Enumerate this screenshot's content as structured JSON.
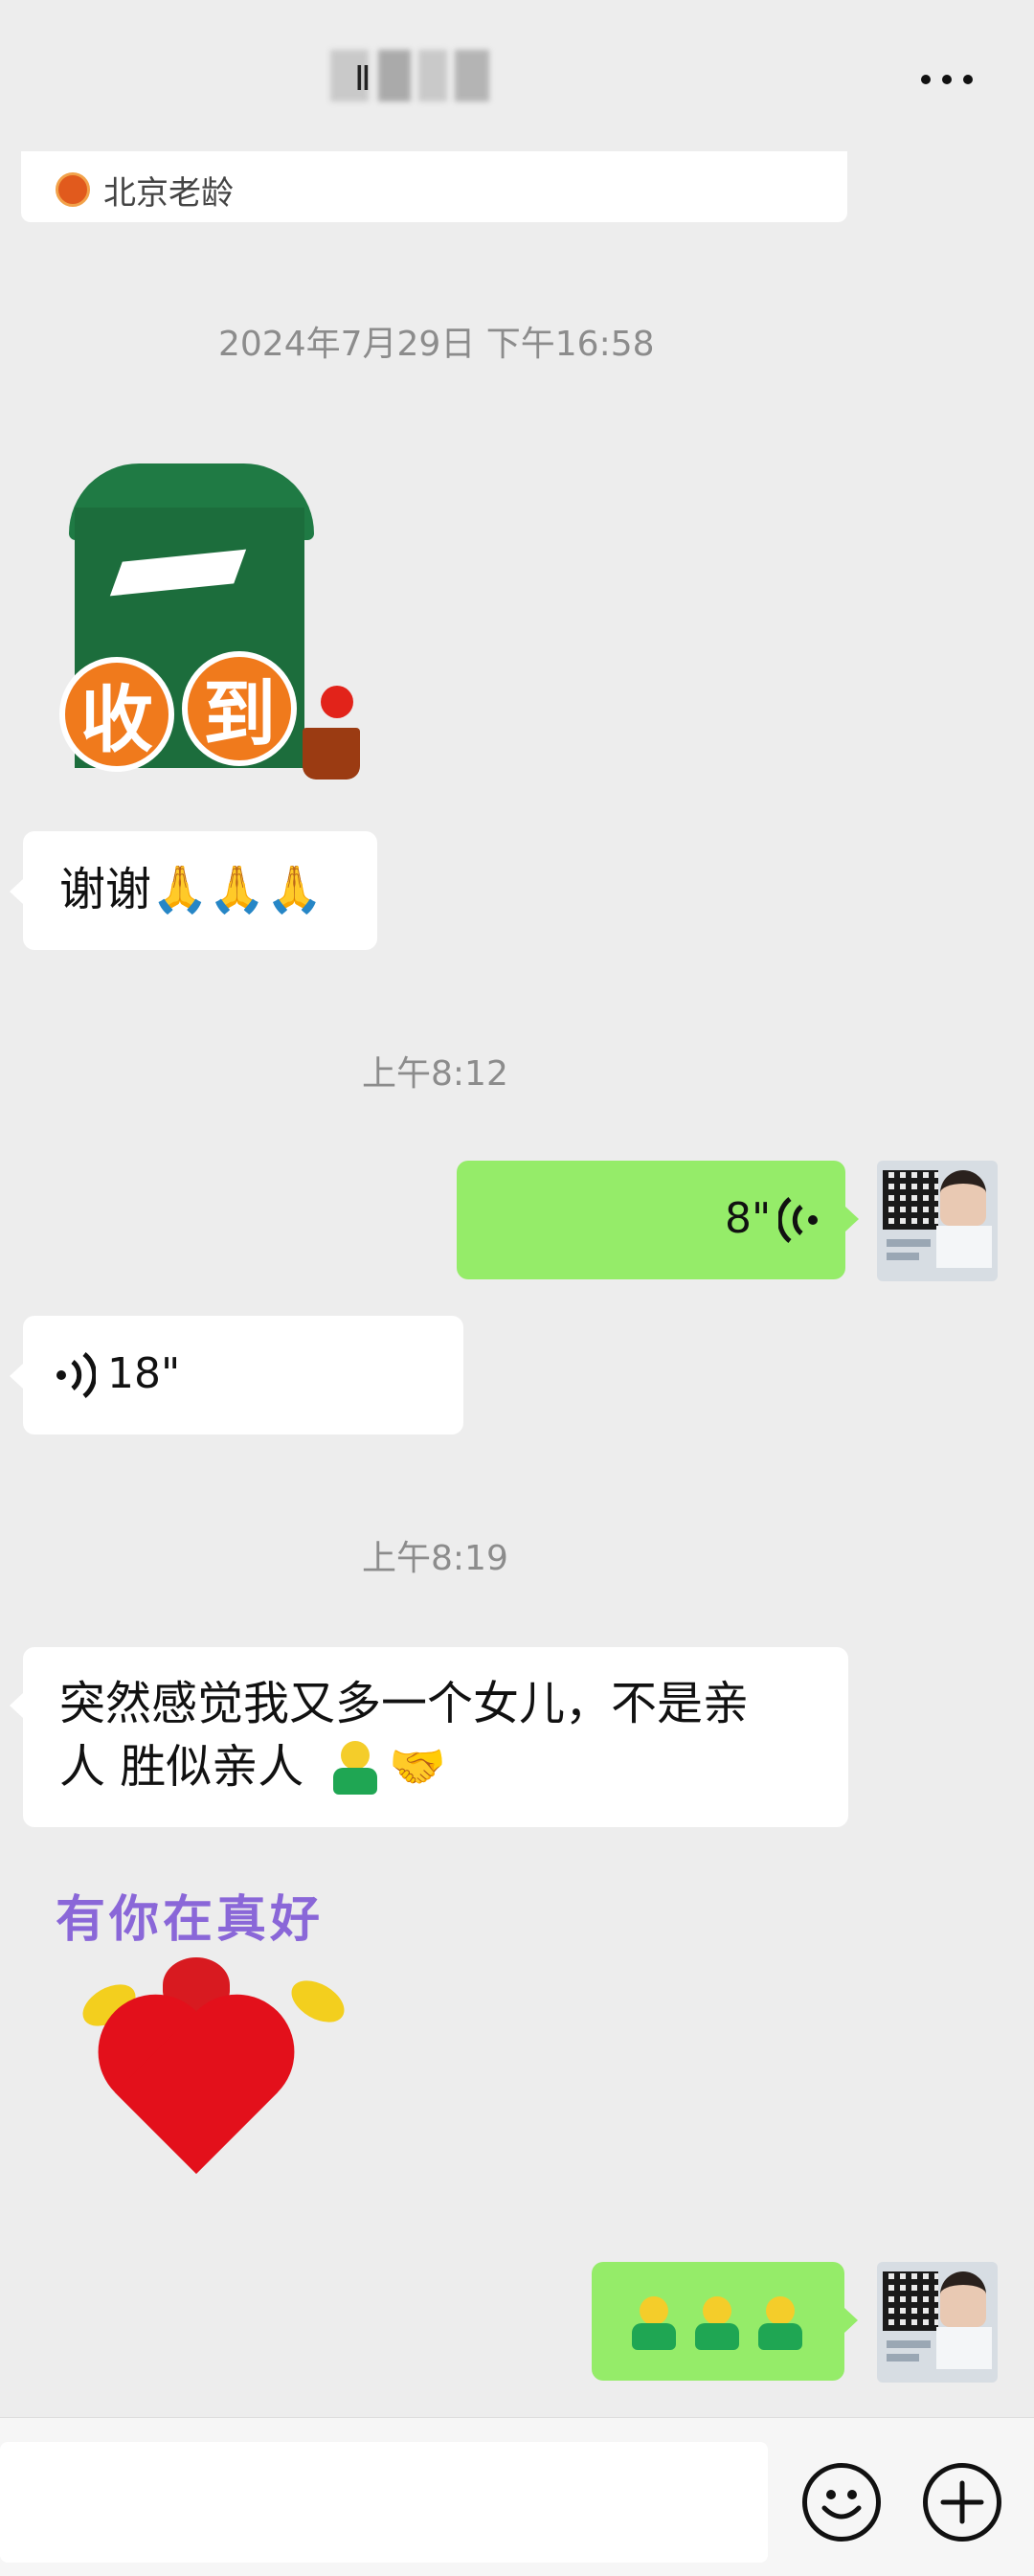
{
  "header": {
    "title": "Ⅱ"
  },
  "quote": {
    "name": "北京老龄"
  },
  "messages": [
    {
      "type": "timestamp",
      "text": "2024年7月29日 下午16:58"
    },
    {
      "type": "sticker",
      "from": "other",
      "sticker_text": [
        "收",
        "到"
      ]
    },
    {
      "type": "text",
      "from": "other",
      "text": "谢谢🙏🙏🙏"
    },
    {
      "type": "timestamp",
      "text": "上午8:12"
    },
    {
      "type": "voice",
      "from": "me",
      "duration": "8\""
    },
    {
      "type": "voice",
      "from": "other",
      "duration": "18\""
    },
    {
      "type": "timestamp",
      "text": "上午8:19"
    },
    {
      "type": "text",
      "from": "other",
      "line1": "突然感觉我又多一个女儿，不是亲",
      "line2": "人 胜似亲人",
      "emoji": "🤝"
    },
    {
      "type": "sticker",
      "from": "other",
      "sticker_text": "有你在真好"
    },
    {
      "type": "emoji",
      "from": "me",
      "emoji": "person x3"
    }
  ],
  "colors": {
    "background": "#ededed",
    "bubble_me": "#95ec69",
    "bubble_other": "#ffffff"
  },
  "icons": [
    "more-icon",
    "voice-icon",
    "emoji-icon",
    "plus-icon"
  ]
}
